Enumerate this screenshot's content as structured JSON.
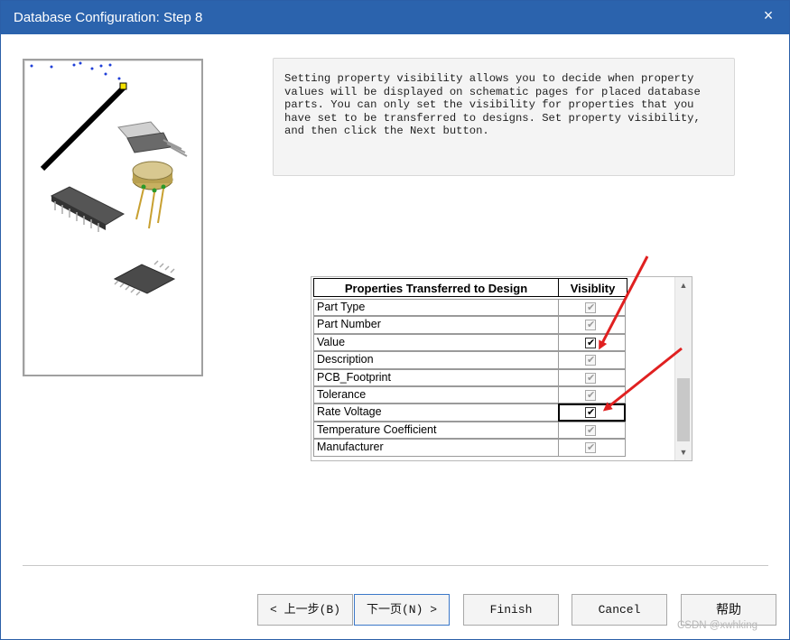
{
  "window": {
    "title": "Database Configuration: Step 8",
    "close_glyph": "×"
  },
  "info": {
    "text": "Setting property visibility allows you to decide when property values will be displayed on schematic pages for placed database parts. You can only set the visibility for properties that you have set to be transferred to designs. Set property visibility, and then click the Next button."
  },
  "grid": {
    "headers": [
      "Properties Transferred to Design",
      "Visiblity"
    ],
    "rows": [
      {
        "name": "Part Type",
        "checked": true,
        "enabled": false
      },
      {
        "name": "Part Number",
        "checked": true,
        "enabled": false
      },
      {
        "name": "Value",
        "checked": true,
        "enabled": true
      },
      {
        "name": "Description",
        "checked": true,
        "enabled": false
      },
      {
        "name": "PCB_Footprint",
        "checked": true,
        "enabled": false
      },
      {
        "name": "Tolerance",
        "checked": true,
        "enabled": false
      },
      {
        "name": "Rate Voltage",
        "checked": true,
        "enabled": true,
        "focused": true
      },
      {
        "name": "Temperature Coefficient",
        "checked": true,
        "enabled": false
      },
      {
        "name": "Manufacturer",
        "checked": true,
        "enabled": false
      }
    ],
    "check_glyph": "✔"
  },
  "buttons": {
    "back": "< 上一步(B)",
    "next": "下一页(N) >",
    "finish": "Finish",
    "cancel": "Cancel",
    "help": "帮助"
  },
  "watermark": "CSDN @xwhking",
  "colors": {
    "title_bar": "#2b63ad",
    "annotation_arrow": "#e02020"
  }
}
